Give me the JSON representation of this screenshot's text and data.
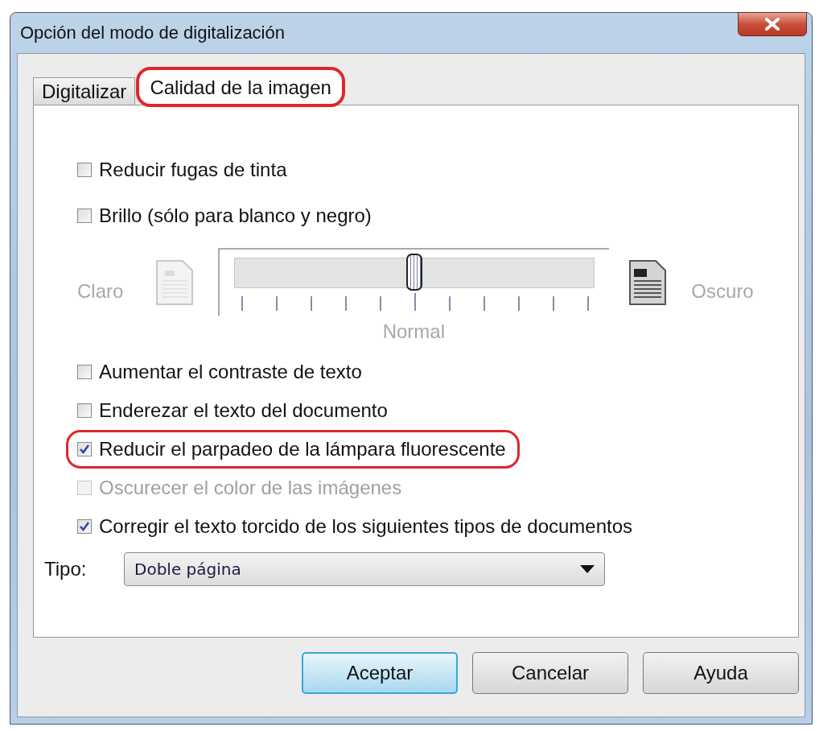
{
  "window": {
    "title": "Opción del modo de digitalización"
  },
  "tabs": [
    {
      "label": "Digitalizar",
      "selected": false,
      "highlighted": false
    },
    {
      "label": "Calidad de la imagen",
      "selected": true,
      "highlighted": true
    }
  ],
  "options": [
    {
      "kind": "checkbox",
      "label": "Reducir fugas de tinta",
      "checked": false,
      "disabled": false,
      "highlighted": false
    },
    {
      "kind": "checkbox",
      "label": "Brillo (sólo para blanco y negro)",
      "checked": false,
      "disabled": false,
      "highlighted": false
    },
    {
      "kind": "slider",
      "left_label": "Claro",
      "right_label": "Oscuro",
      "center_label": "Normal",
      "level": 0.5,
      "disabled": true
    },
    {
      "kind": "checkbox",
      "label": "Aumentar el contraste de texto",
      "checked": false,
      "disabled": false,
      "highlighted": false
    },
    {
      "kind": "checkbox",
      "label": "Enderezar el texto del documento",
      "checked": false,
      "disabled": false,
      "highlighted": false
    },
    {
      "kind": "checkbox",
      "label": "Reducir el parpadeo de la lámpara fluorescente",
      "checked": true,
      "disabled": false,
      "highlighted": true
    },
    {
      "kind": "checkbox",
      "label": "Oscurecer el color de las imágenes",
      "checked": false,
      "disabled": true,
      "highlighted": false
    },
    {
      "kind": "checkbox",
      "label": "Corregir el texto torcido de los siguientes tipos de documentos",
      "checked": true,
      "disabled": false,
      "highlighted": false
    },
    {
      "kind": "select",
      "label": "Tipo:",
      "value": "Doble página"
    }
  ],
  "buttons": [
    {
      "label": "Aceptar",
      "default": true
    },
    {
      "label": "Cancelar",
      "default": false
    },
    {
      "label": "Ayuda",
      "default": false
    }
  ]
}
